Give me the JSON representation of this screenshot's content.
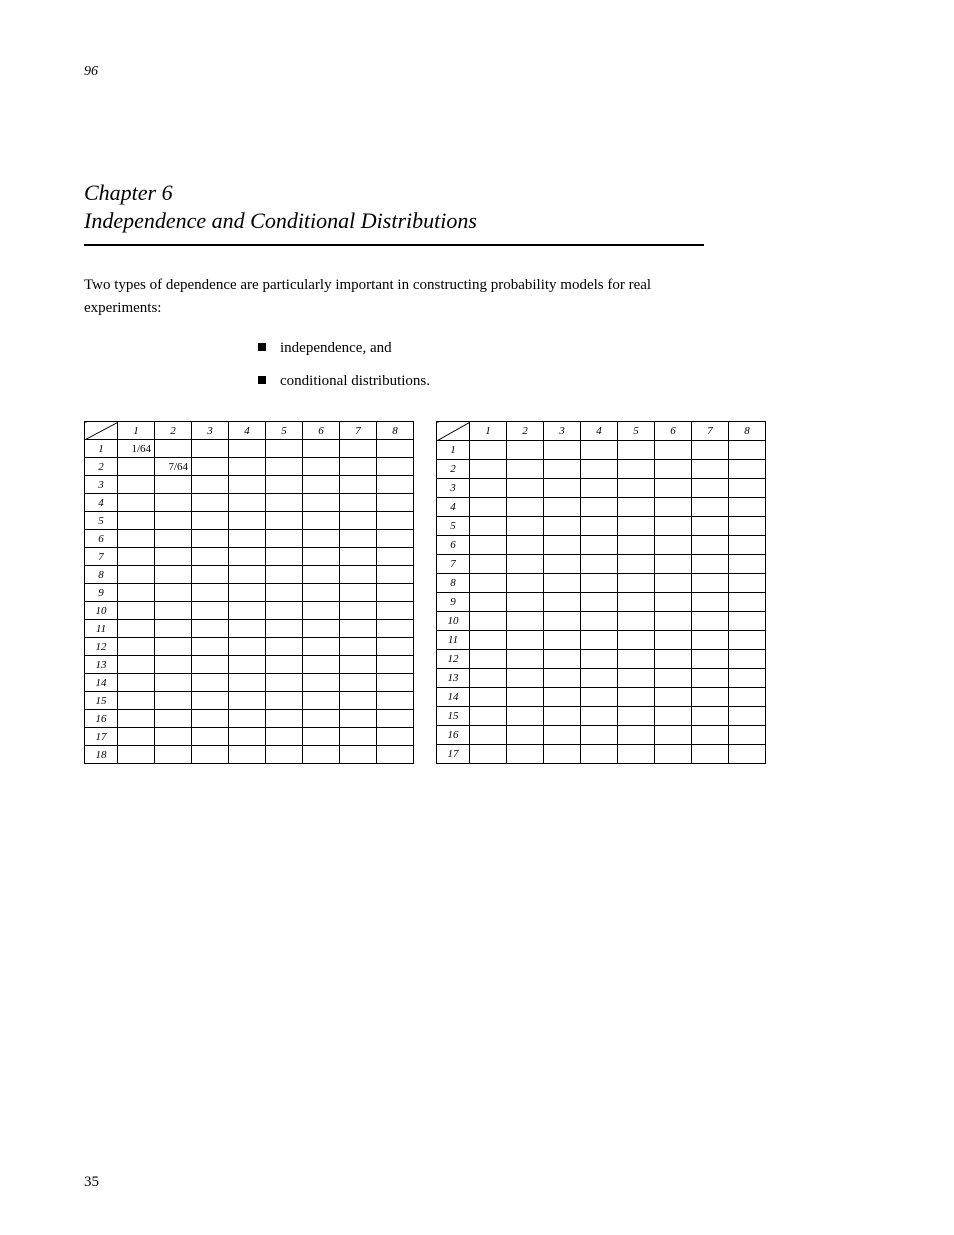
{
  "header_num": "96",
  "title": "Chapter 6",
  "subtitle": "Independence and Conditional Distributions",
  "paragraph": "Two types of dependence are particularly important in constructing probability models for real experiments:",
  "bullets": [
    "independence, and",
    "conditional distributions."
  ],
  "tableA": {
    "cols": [
      "1",
      "2",
      "3",
      "4",
      "5",
      "6",
      "7",
      "8"
    ],
    "rows": [
      {
        "i": "1",
        "v": [
          "1/64",
          "",
          "",
          "",
          "",
          "",
          "",
          ""
        ]
      },
      {
        "i": "2",
        "v": [
          "",
          "7/64",
          "",
          "",
          "",
          "",
          "",
          ""
        ]
      },
      {
        "i": "3",
        "v": [
          "",
          "",
          "",
          "",
          "",
          "",
          "",
          ""
        ]
      },
      {
        "i": "4",
        "v": [
          "",
          "",
          "",
          "",
          "",
          "",
          "",
          ""
        ]
      },
      {
        "i": "5",
        "v": [
          "",
          "",
          "",
          "",
          "",
          "",
          "",
          ""
        ]
      },
      {
        "i": "6",
        "v": [
          "",
          "",
          "",
          "",
          "",
          "",
          "",
          ""
        ]
      },
      {
        "i": "7",
        "v": [
          "",
          "",
          "",
          "",
          "",
          "",
          "",
          ""
        ]
      },
      {
        "i": "8",
        "v": [
          "",
          "",
          "",
          "",
          "",
          "",
          "",
          ""
        ]
      },
      {
        "i": "9",
        "v": [
          "",
          "",
          "",
          "",
          "",
          "",
          "",
          ""
        ]
      },
      {
        "i": "10",
        "v": [
          "",
          "",
          "",
          "",
          "",
          "",
          "",
          ""
        ]
      },
      {
        "i": "11",
        "v": [
          "",
          "",
          "",
          "",
          "",
          "",
          "",
          ""
        ]
      },
      {
        "i": "12",
        "v": [
          "",
          "",
          "",
          "",
          "",
          "",
          "",
          ""
        ]
      },
      {
        "i": "13",
        "v": [
          "",
          "",
          "",
          "",
          "",
          "",
          "",
          ""
        ]
      },
      {
        "i": "14",
        "v": [
          "",
          "",
          "",
          "",
          "",
          "",
          "",
          ""
        ]
      },
      {
        "i": "15",
        "v": [
          "",
          "",
          "",
          "",
          "",
          "",
          "",
          ""
        ]
      },
      {
        "i": "16",
        "v": [
          "",
          "",
          "",
          "",
          "",
          "",
          "",
          ""
        ]
      },
      {
        "i": "17",
        "v": [
          "",
          "",
          "",
          "",
          "",
          "",
          "",
          ""
        ]
      },
      {
        "i": "18",
        "v": [
          "",
          "",
          "",
          "",
          "",
          "",
          "",
          ""
        ]
      }
    ]
  },
  "tableB": {
    "cols": [
      "1",
      "2",
      "3",
      "4",
      "5",
      "6",
      "7",
      "8"
    ],
    "rows": [
      {
        "i": "1",
        "v": [
          "",
          "",
          "",
          "",
          "",
          "",
          "",
          ""
        ]
      },
      {
        "i": "2",
        "v": [
          "",
          "",
          "",
          "",
          "",
          "",
          "",
          ""
        ]
      },
      {
        "i": "3",
        "v": [
          "",
          "",
          "",
          "",
          "",
          "",
          "",
          ""
        ]
      },
      {
        "i": "4",
        "v": [
          "",
          "",
          "",
          "",
          "",
          "",
          "",
          ""
        ]
      },
      {
        "i": "5",
        "v": [
          "",
          "",
          "",
          "",
          "",
          "",
          "",
          ""
        ]
      },
      {
        "i": "6",
        "v": [
          "",
          "",
          "",
          "",
          "",
          "",
          "",
          ""
        ]
      },
      {
        "i": "7",
        "v": [
          "",
          "",
          "",
          "",
          "",
          "",
          "",
          ""
        ]
      },
      {
        "i": "8",
        "v": [
          "",
          "",
          "",
          "",
          "",
          "",
          "",
          ""
        ]
      },
      {
        "i": "9",
        "v": [
          "",
          "",
          "",
          "",
          "",
          "",
          "",
          ""
        ]
      },
      {
        "i": "10",
        "v": [
          "",
          "",
          "",
          "",
          "",
          "",
          "",
          ""
        ]
      },
      {
        "i": "11",
        "v": [
          "",
          "",
          "",
          "",
          "",
          "",
          "",
          ""
        ]
      },
      {
        "i": "12",
        "v": [
          "",
          "",
          "",
          "",
          "",
          "",
          "",
          ""
        ]
      },
      {
        "i": "13",
        "v": [
          "",
          "",
          "",
          "",
          "",
          "",
          "",
          ""
        ]
      },
      {
        "i": "14",
        "v": [
          "",
          "",
          "",
          "",
          "",
          "",
          "",
          ""
        ]
      },
      {
        "i": "15",
        "v": [
          "",
          "",
          "",
          "",
          "",
          "",
          "",
          ""
        ]
      },
      {
        "i": "16",
        "v": [
          "",
          "",
          "",
          "",
          "",
          "",
          "",
          ""
        ]
      },
      {
        "i": "17",
        "v": [
          "",
          "",
          "",
          "",
          "",
          "",
          "",
          ""
        ]
      }
    ]
  },
  "footer": "35"
}
